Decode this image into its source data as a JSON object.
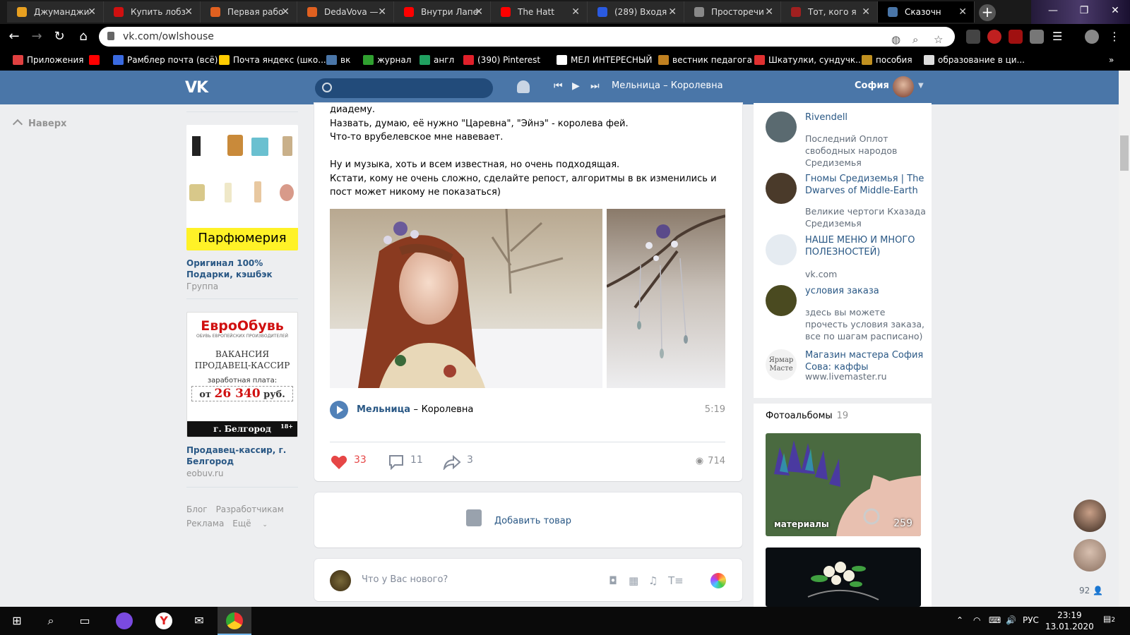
{
  "browser": {
    "tabs": [
      {
        "title": "Джуманджи",
        "color": "#e8a020"
      },
      {
        "title": "Купить лобз",
        "color": "#d01010"
      },
      {
        "title": "Первая рабо",
        "color": "#e06020"
      },
      {
        "title": "DedaVova —",
        "color": "#e06020"
      },
      {
        "title": "Внутри Лапе",
        "color": "#ff0000"
      },
      {
        "title": "The Hatt",
        "color": "#ff0000"
      },
      {
        "title": "(289) Входя",
        "color": "#2a5ae0"
      },
      {
        "title": "Просторечи",
        "color": "#888888"
      },
      {
        "title": "Тот, кого я",
        "color": "#a02020"
      },
      {
        "title": "Сказочн",
        "color": "#4a76a8"
      }
    ],
    "new_tab": "+",
    "url": "vk.com/owlshouse",
    "bookmarks": [
      {
        "label": "Приложения",
        "color": "#e04040"
      },
      {
        "label": "",
        "color": "#ff0000"
      },
      {
        "label": "Рамблер почта (всё)",
        "color": "#3a6ae0"
      },
      {
        "label": "Почта яндекс (шко...",
        "color": "#ffcc00"
      },
      {
        "label": "вк",
        "color": "#4a76a8"
      },
      {
        "label": "журнал",
        "color": "#30a030"
      },
      {
        "label": "англ",
        "color": "#20a060"
      },
      {
        "label": "(390) Pinterest",
        "color": "#e0202a"
      },
      {
        "label": "МЕЛ ИНТЕРЕСНЫЙ",
        "color": "#ffffff"
      },
      {
        "label": "вестник педагога",
        "color": "#c08020"
      },
      {
        "label": "Шкатулки, сундучк...",
        "color": "#e03030"
      },
      {
        "label": "пособия",
        "color": "#c09020"
      },
      {
        "label": "образование в ци...",
        "color": "#dddddd"
      }
    ],
    "more": "»"
  },
  "vk": {
    "logo": "VK",
    "player_track": "Мельница – Королевна",
    "user_name": "София",
    "to_top": "Наверх"
  },
  "ads": [
    {
      "banner": "Парфюмерия",
      "title": "Оригинал 100% Подарки, кэшбэк",
      "sub": "Группа"
    },
    {
      "brand": "ЕвроОбувь",
      "tagline": "ОБУВЬ ЕВРОПЕЙСКИХ ПРОИЗВОДИТЕЛЕЙ",
      "vacancy": "ВАКАНСИЯ ПРОДАВЕЦ-КАССИР",
      "salary_label": "заработная плата:",
      "salary_prefix": "от",
      "salary_value": "26 340",
      "salary_unit": "руб.",
      "city": "г. Белгород",
      "age": "18+",
      "title": "Продавец-кассир, г. Белгород",
      "sub": "eobuv.ru"
    }
  ],
  "footer_links": [
    "Блог",
    "Разработчикам",
    "Реклама",
    "Ещё"
  ],
  "post": {
    "lines": [
      "диадему.",
      "Назвать, думаю, её нужно \"Царевна\", \"Эйнэ\" - королева фей.",
      "Что-то врубелевское мне навевает.",
      "",
      "Ну и музыка, хоть и всем известная, но очень подходящая.",
      "Кстати, кому не очень сложно, сделайте репост, алгоритмы в вк изменились и",
      "пост может никому не показаться)"
    ],
    "audio": {
      "artist": "Мельница",
      "dash": "–",
      "title": "Королевна",
      "duration": "5:19"
    },
    "likes": "33",
    "comments": "11",
    "shares": "3",
    "views": "714"
  },
  "add_product": "Добавить товар",
  "new_post_placeholder": "Что у Вас нового?",
  "links": [
    {
      "name": "Rivendell",
      "desc": "Последний Оплот свободных народов Средиземья",
      "color": "#5a6a70"
    },
    {
      "name": "Гномы Средиземья | The Dwarves of Middle-Earth",
      "desc": "Великие чертоги Кхазада Средиземья",
      "color": "#4a3a2a"
    },
    {
      "name": "НАШЕ МЕНЮ И МНОГО ПОЛЕЗНОСТЕЙ)",
      "desc": "vk.com",
      "color": "#e5ebf1"
    },
    {
      "name": "условия заказа",
      "desc": "здесь вы можете прочесть условия заказа, все по шагам расписано)",
      "color": "#4a4a20"
    },
    {
      "name": "Магазин мастера София Сова: каффы",
      "desc": "www.livemaster.ru",
      "color": "#f2f2f2",
      "logo": "Ярмар Масте"
    }
  ],
  "albums": {
    "title": "Фотоальбомы",
    "count": "19",
    "items": [
      {
        "label": "материалы",
        "count": "259"
      }
    ]
  },
  "friends_online": "92",
  "taskbar": {
    "lang": "РУС",
    "time": "23:19",
    "date": "13.01.2020",
    "notif": "2"
  }
}
